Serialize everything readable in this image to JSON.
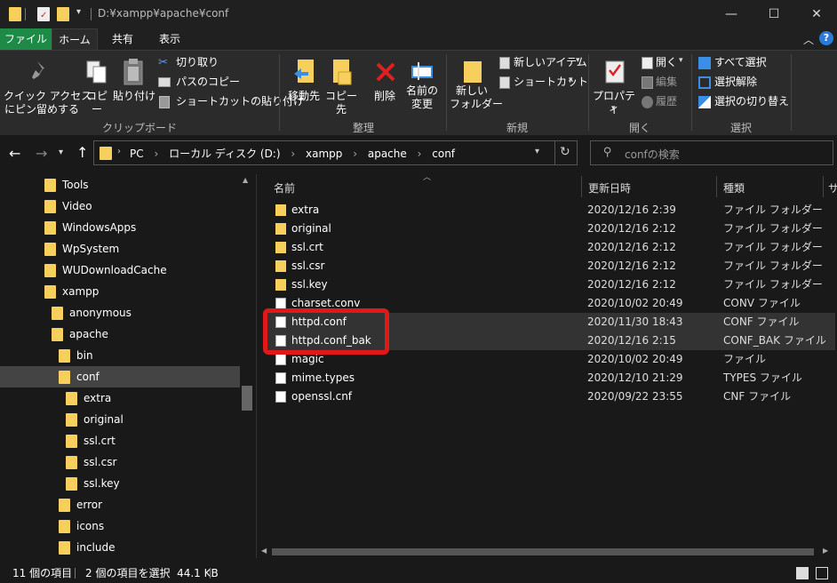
{
  "window": {
    "title": "D:¥xampp¥apache¥conf",
    "min": "—",
    "max": "☐",
    "close": "✕"
  },
  "tabs": [
    "ファイル",
    "ホーム",
    "共有",
    "表示"
  ],
  "ribbon": {
    "pin_label": "クイック アクセス\nにピン留めする",
    "copy_label": "コピー",
    "paste_label": "貼り付け",
    "cut_label": "切り取り",
    "copy_path_label": "パスのコピー",
    "paste_shortcut_label": "ショートカットの貼り付け",
    "group_clipboard": "クリップボード",
    "move_to_label": "移動先",
    "copy_to_label": "コピー先",
    "delete_label": "削除",
    "rename_label": "名前の\n変更",
    "group_organize": "整理",
    "new_folder_label": "新しい\nフォルダー",
    "new_item_label": "新しいアイテム",
    "shortcut_label": "ショートカット",
    "group_new": "新規",
    "properties_label": "プロパティ",
    "open_label": "開く",
    "edit_label": "編集",
    "history_label": "履歴",
    "group_open": "開く",
    "select_all_label": "すべて選択",
    "select_none_label": "選択解除",
    "invert_label": "選択の切り替え",
    "group_select": "選択"
  },
  "address": {
    "crumbs": [
      "PC",
      "ローカル ディスク (D:)",
      "xampp",
      "apache",
      "conf"
    ],
    "search_placeholder": "confの検索"
  },
  "nav": {
    "items": [
      {
        "label": "Tools",
        "indent": 0
      },
      {
        "label": "Video",
        "indent": 0
      },
      {
        "label": "WindowsApps",
        "indent": 0
      },
      {
        "label": "WpSystem",
        "indent": 0
      },
      {
        "label": "WUDownloadCache",
        "indent": 0
      },
      {
        "label": "xampp",
        "indent": 0
      },
      {
        "label": "anonymous",
        "indent": 1
      },
      {
        "label": "apache",
        "indent": 1
      },
      {
        "label": "bin",
        "indent": 2
      },
      {
        "label": "conf",
        "indent": 2
      },
      {
        "label": "extra",
        "indent": 3
      },
      {
        "label": "original",
        "indent": 3
      },
      {
        "label": "ssl.crt",
        "indent": 3
      },
      {
        "label": "ssl.csr",
        "indent": 3
      },
      {
        "label": "ssl.key",
        "indent": 3
      },
      {
        "label": "error",
        "indent": 2
      },
      {
        "label": "icons",
        "indent": 2
      },
      {
        "label": "include",
        "indent": 2
      }
    ]
  },
  "columns": {
    "name": "名前",
    "date": "更新日時",
    "type": "種類",
    "size": "サ"
  },
  "files": [
    {
      "name": "extra",
      "date": "2020/12/16 2:39",
      "type": "ファイル フォルダー",
      "kind": "folder"
    },
    {
      "name": "original",
      "date": "2020/12/16 2:12",
      "type": "ファイル フォルダー",
      "kind": "folder"
    },
    {
      "name": "ssl.crt",
      "date": "2020/12/16 2:12",
      "type": "ファイル フォルダー",
      "kind": "folder"
    },
    {
      "name": "ssl.csr",
      "date": "2020/12/16 2:12",
      "type": "ファイル フォルダー",
      "kind": "folder"
    },
    {
      "name": "ssl.key",
      "date": "2020/12/16 2:12",
      "type": "ファイル フォルダー",
      "kind": "folder"
    },
    {
      "name": "charset.conv",
      "date": "2020/10/02 20:49",
      "type": "CONV ファイル",
      "kind": "file"
    },
    {
      "name": "httpd.conf",
      "date": "2020/11/30 18:43",
      "type": "CONF ファイル",
      "kind": "file",
      "selected": true
    },
    {
      "name": "httpd.conf_bak",
      "date": "2020/12/16 2:15",
      "type": "CONF_BAK ファイル",
      "kind": "file",
      "selected": true
    },
    {
      "name": "magic",
      "date": "2020/10/02 20:49",
      "type": "ファイル",
      "kind": "file"
    },
    {
      "name": "mime.types",
      "date": "2020/12/10 21:29",
      "type": "TYPES ファイル",
      "kind": "file"
    },
    {
      "name": "openssl.cnf",
      "date": "2020/09/22 23:55",
      "type": "CNF ファイル",
      "kind": "file"
    }
  ],
  "status": {
    "count": "11 個の項目",
    "selection": "2 個の項目を選択  44.1 KB"
  },
  "colors": {
    "accent_file_tab": "#1e8a48",
    "highlight": "#e01818",
    "folder": "#f7cf5c"
  }
}
